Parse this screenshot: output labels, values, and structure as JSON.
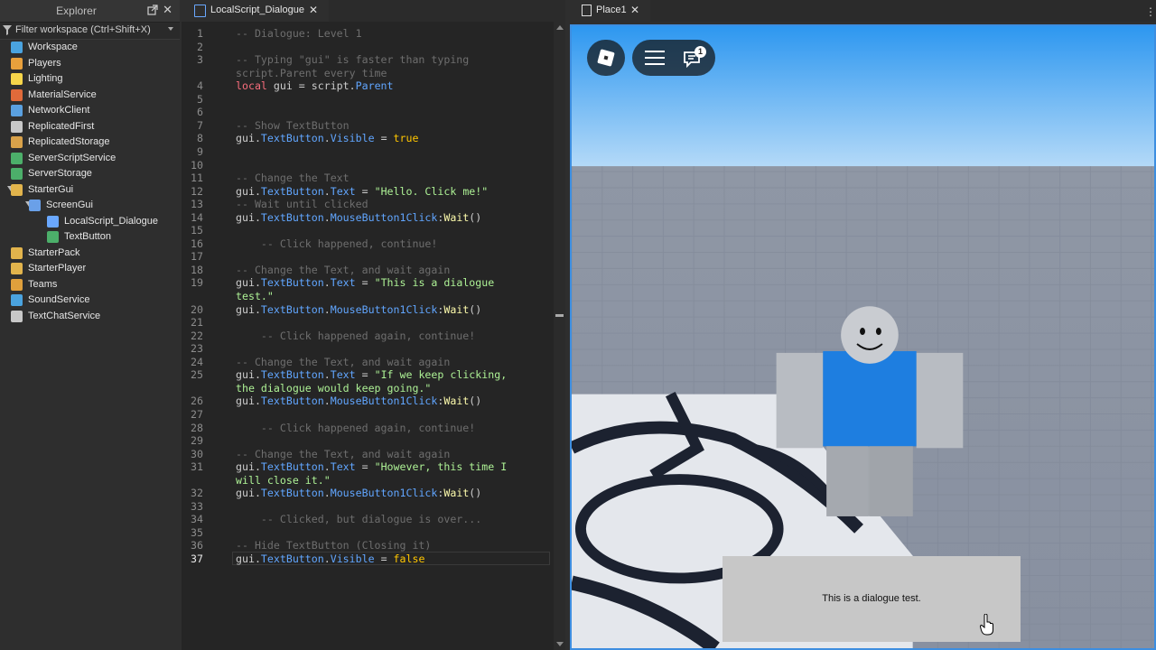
{
  "explorer": {
    "title": "Explorer",
    "filter_placeholder": "Filter workspace (Ctrl+Shift+X)",
    "items": [
      {
        "label": "Workspace",
        "icon": "globe-icon",
        "color": "#4aa3df"
      },
      {
        "label": "Players",
        "icon": "players-icon",
        "color": "#e8a03c"
      },
      {
        "label": "Lighting",
        "icon": "lightbulb-icon",
        "color": "#f6d54a"
      },
      {
        "label": "MaterialService",
        "icon": "material-icon",
        "color": "#e06a3a"
      },
      {
        "label": "NetworkClient",
        "icon": "network-icon",
        "color": "#5aa0e0"
      },
      {
        "label": "ReplicatedFirst",
        "icon": "replicated-first-icon",
        "color": "#c8c8c8"
      },
      {
        "label": "ReplicatedStorage",
        "icon": "replicated-storage-icon",
        "color": "#d9a24a"
      },
      {
        "label": "ServerScriptService",
        "icon": "server-script-icon",
        "color": "#4caf6a"
      },
      {
        "label": "ServerStorage",
        "icon": "server-storage-icon",
        "color": "#4caf6a"
      },
      {
        "label": "StarterGui",
        "icon": "folder-icon",
        "color": "#e2b44c"
      },
      {
        "label": "ScreenGui",
        "icon": "screen-gui-icon",
        "color": "#6aa0e8"
      },
      {
        "label": "LocalScript_Dialogue",
        "icon": "local-script-icon",
        "color": "#6aa8ff"
      },
      {
        "label": "TextButton",
        "icon": "text-button-icon",
        "color": "#4caf6a"
      },
      {
        "label": "StarterPack",
        "icon": "folder-icon",
        "color": "#e2b44c"
      },
      {
        "label": "StarterPlayer",
        "icon": "folder-icon",
        "color": "#e2b44c"
      },
      {
        "label": "Teams",
        "icon": "teams-icon",
        "color": "#e0a03c"
      },
      {
        "label": "SoundService",
        "icon": "sound-icon",
        "color": "#4aa3df"
      },
      {
        "label": "TextChatService",
        "icon": "chat-icon",
        "color": "#c8c8c8"
      }
    ]
  },
  "editor": {
    "tab_label": "LocalScript_Dialogue",
    "current_line": 37,
    "lines": [
      {
        "n": "1",
        "tokens": [
          [
            "c",
            "-- Dialogue: Level 1"
          ]
        ]
      },
      {
        "n": "2",
        "tokens": []
      },
      {
        "n": "3",
        "tokens": [
          [
            "c",
            "-- Typing \"gui\" is faster than typing"
          ]
        ]
      },
      {
        "n": "",
        "tokens": [
          [
            "c",
            "script.Parent every time"
          ]
        ]
      },
      {
        "n": "4",
        "tokens": [
          [
            "k",
            "local"
          ],
          [
            "i",
            " gui = script."
          ],
          [
            "p",
            "Parent"
          ]
        ]
      },
      {
        "n": "5",
        "tokens": []
      },
      {
        "n": "6",
        "tokens": []
      },
      {
        "n": "7",
        "tokens": [
          [
            "c",
            "-- Show TextButton"
          ]
        ]
      },
      {
        "n": "8",
        "tokens": [
          [
            "i",
            "gui."
          ],
          [
            "p",
            "TextButton"
          ],
          [
            "i",
            "."
          ],
          [
            "p",
            "Visible"
          ],
          [
            "i",
            " = "
          ],
          [
            "b",
            "true"
          ]
        ]
      },
      {
        "n": "9",
        "tokens": []
      },
      {
        "n": "10",
        "tokens": []
      },
      {
        "n": "11",
        "tokens": [
          [
            "c",
            "-- Change the Text"
          ]
        ]
      },
      {
        "n": "12",
        "tokens": [
          [
            "i",
            "gui."
          ],
          [
            "p",
            "TextButton"
          ],
          [
            "i",
            "."
          ],
          [
            "p",
            "Text"
          ],
          [
            "i",
            " = "
          ],
          [
            "s",
            "\"Hello. Click me!\""
          ]
        ]
      },
      {
        "n": "13",
        "tokens": [
          [
            "c",
            "-- Wait until clicked"
          ]
        ]
      },
      {
        "n": "14",
        "tokens": [
          [
            "i",
            "gui."
          ],
          [
            "p",
            "TextButton"
          ],
          [
            "i",
            "."
          ],
          [
            "p",
            "MouseButton1Click"
          ],
          [
            "i",
            ":"
          ],
          [
            "m",
            "Wait"
          ],
          [
            "i",
            "()"
          ]
        ]
      },
      {
        "n": "15",
        "tokens": []
      },
      {
        "n": "16",
        "tokens": [
          [
            "i",
            "    "
          ],
          [
            "c",
            "-- Click happened, continue!"
          ]
        ]
      },
      {
        "n": "17",
        "tokens": []
      },
      {
        "n": "18",
        "tokens": [
          [
            "c",
            "-- Change the Text, and wait again"
          ]
        ]
      },
      {
        "n": "19",
        "tokens": [
          [
            "i",
            "gui."
          ],
          [
            "p",
            "TextButton"
          ],
          [
            "i",
            "."
          ],
          [
            "p",
            "Text"
          ],
          [
            "i",
            " = "
          ],
          [
            "s",
            "\"This is a dialogue"
          ]
        ]
      },
      {
        "n": "",
        "tokens": [
          [
            "s",
            "test.\""
          ]
        ]
      },
      {
        "n": "20",
        "tokens": [
          [
            "i",
            "gui."
          ],
          [
            "p",
            "TextButton"
          ],
          [
            "i",
            "."
          ],
          [
            "p",
            "MouseButton1Click"
          ],
          [
            "i",
            ":"
          ],
          [
            "m",
            "Wait"
          ],
          [
            "i",
            "()"
          ]
        ]
      },
      {
        "n": "21",
        "tokens": []
      },
      {
        "n": "22",
        "tokens": [
          [
            "i",
            "    "
          ],
          [
            "c",
            "-- Click happened again, continue!"
          ]
        ]
      },
      {
        "n": "23",
        "tokens": []
      },
      {
        "n": "24",
        "tokens": [
          [
            "c",
            "-- Change the Text, and wait again"
          ]
        ]
      },
      {
        "n": "25",
        "tokens": [
          [
            "i",
            "gui."
          ],
          [
            "p",
            "TextButton"
          ],
          [
            "i",
            "."
          ],
          [
            "p",
            "Text"
          ],
          [
            "i",
            " = "
          ],
          [
            "s",
            "\"If we keep clicking,"
          ]
        ]
      },
      {
        "n": "",
        "tokens": [
          [
            "s",
            "the dialogue would keep going.\""
          ]
        ]
      },
      {
        "n": "26",
        "tokens": [
          [
            "i",
            "gui."
          ],
          [
            "p",
            "TextButton"
          ],
          [
            "i",
            "."
          ],
          [
            "p",
            "MouseButton1Click"
          ],
          [
            "i",
            ":"
          ],
          [
            "m",
            "Wait"
          ],
          [
            "i",
            "()"
          ]
        ]
      },
      {
        "n": "27",
        "tokens": []
      },
      {
        "n": "28",
        "tokens": [
          [
            "i",
            "    "
          ],
          [
            "c",
            "-- Click happened again, continue!"
          ]
        ]
      },
      {
        "n": "29",
        "tokens": []
      },
      {
        "n": "30",
        "tokens": [
          [
            "c",
            "-- Change the Text, and wait again"
          ]
        ]
      },
      {
        "n": "31",
        "tokens": [
          [
            "i",
            "gui."
          ],
          [
            "p",
            "TextButton"
          ],
          [
            "i",
            "."
          ],
          [
            "p",
            "Text"
          ],
          [
            "i",
            " = "
          ],
          [
            "s",
            "\"However, this time I"
          ]
        ]
      },
      {
        "n": "",
        "tokens": [
          [
            "s",
            "will close it.\""
          ]
        ]
      },
      {
        "n": "32",
        "tokens": [
          [
            "i",
            "gui."
          ],
          [
            "p",
            "TextButton"
          ],
          [
            "i",
            "."
          ],
          [
            "p",
            "MouseButton1Click"
          ],
          [
            "i",
            ":"
          ],
          [
            "m",
            "Wait"
          ],
          [
            "i",
            "()"
          ]
        ]
      },
      {
        "n": "33",
        "tokens": []
      },
      {
        "n": "34",
        "tokens": [
          [
            "i",
            "    "
          ],
          [
            "c",
            "-- Clicked, but dialogue is over..."
          ]
        ]
      },
      {
        "n": "35",
        "tokens": []
      },
      {
        "n": "36",
        "tokens": [
          [
            "c",
            "-- Hide TextButton (Closing it)"
          ]
        ]
      },
      {
        "n": "37",
        "tokens": [
          [
            "i",
            "gui."
          ],
          [
            "p",
            "TextButton"
          ],
          [
            "i",
            "."
          ],
          [
            "p",
            "Visible"
          ],
          [
            "i",
            " = "
          ],
          [
            "b",
            "false"
          ]
        ]
      }
    ]
  },
  "viewport": {
    "tab_label": "Place1",
    "chat_badge": "1",
    "dialogue_text": "This is a dialogue test."
  },
  "colors": {
    "accent": "#3d8ee0",
    "comment": "#6e6e6e",
    "keyword": "#f86d7c",
    "property": "#61a6ff",
    "string": "#adf195",
    "boolean": "#ffc600",
    "method": "#fdfbac"
  }
}
